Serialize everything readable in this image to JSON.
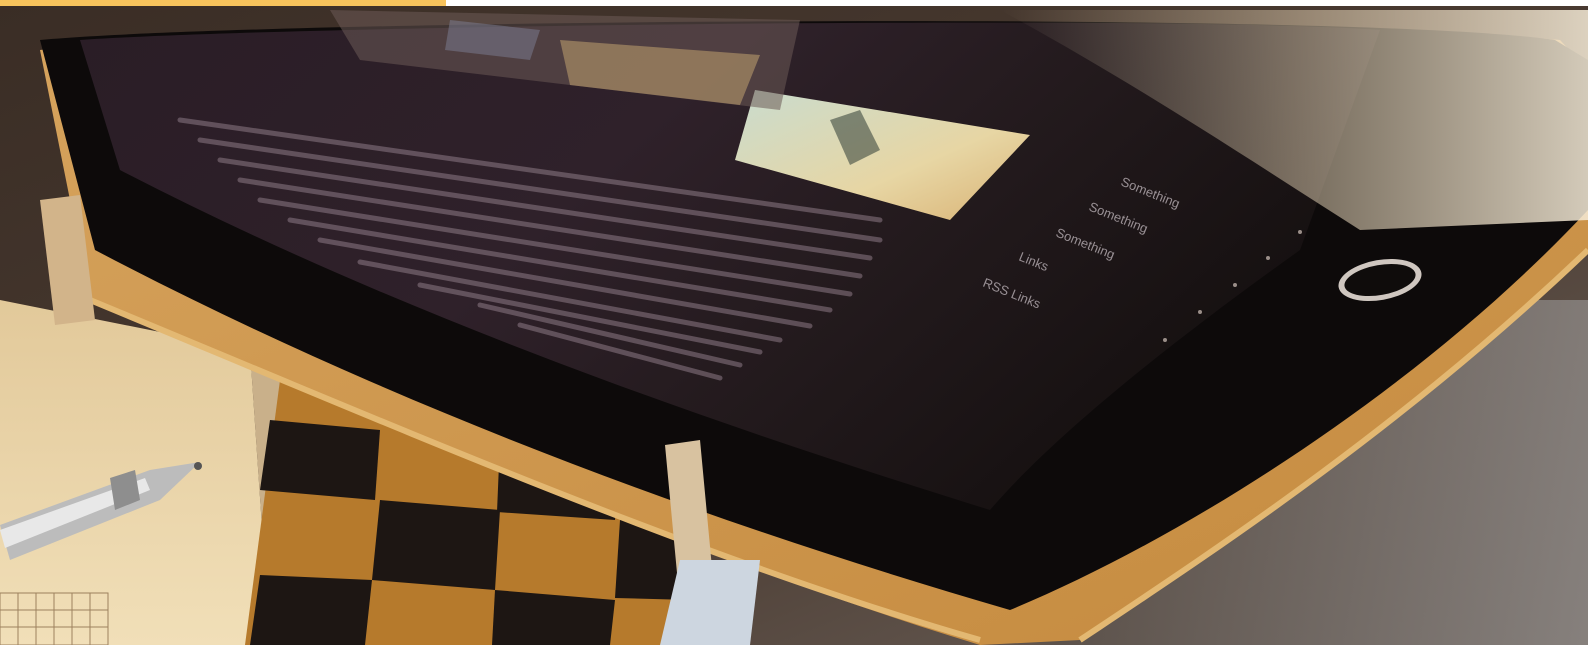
{
  "image": {
    "subject": "photo",
    "accent_bar_color": "#f7c35c"
  },
  "tablet_menu": {
    "items": [
      "Something",
      "Something",
      "Something",
      "Links",
      "RSS Links"
    ]
  }
}
